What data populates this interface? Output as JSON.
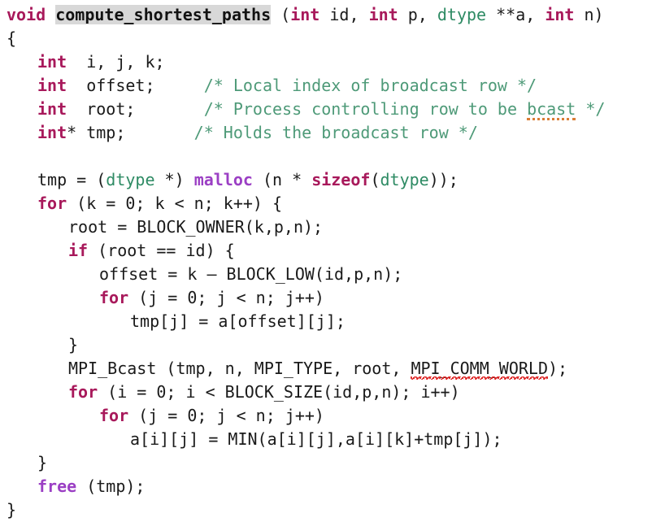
{
  "document": {
    "kind": "source-code-listing",
    "language": "C",
    "function_name": "compute_shortest_paths",
    "background_color": "#ffffff"
  },
  "theme": {
    "plain_color": "#1a1a1a",
    "keyword_color": "#a8195b",
    "builtin_color": "#9b3fc4",
    "type_color": "#2e8b64",
    "comment_color": "#4e9a78",
    "funcname_highlight_bg": "#d8d8d8",
    "spell_error_color": "#d42020",
    "grammar_warning_color": "#d9772b"
  },
  "lines": [
    {
      "indent": 0,
      "tokens": [
        {
          "text": "void",
          "type": "keyword"
        },
        {
          "text": " ",
          "type": "plain"
        },
        {
          "text": "compute_shortest_paths",
          "type": "funcname"
        },
        {
          "text": " (",
          "type": "plain"
        },
        {
          "text": "int",
          "type": "keyword"
        },
        {
          "text": " id, ",
          "type": "plain"
        },
        {
          "text": "int",
          "type": "keyword"
        },
        {
          "text": " p, ",
          "type": "plain"
        },
        {
          "text": "dtype",
          "type": "type"
        },
        {
          "text": " **a, ",
          "type": "plain"
        },
        {
          "text": "int",
          "type": "keyword"
        },
        {
          "text": " n)",
          "type": "plain"
        }
      ]
    },
    {
      "indent": 0,
      "tokens": [
        {
          "text": "{",
          "type": "plain"
        }
      ]
    },
    {
      "indent": 1,
      "tokens": [
        {
          "text": "int",
          "type": "keyword"
        },
        {
          "text": "  i, j, k;",
          "type": "plain"
        }
      ]
    },
    {
      "indent": 1,
      "tokens": [
        {
          "text": "int",
          "type": "keyword"
        },
        {
          "text": "  offset;     ",
          "type": "plain"
        },
        {
          "text": "/* Local index of broadcast row */",
          "type": "comment"
        }
      ]
    },
    {
      "indent": 1,
      "tokens": [
        {
          "text": "int",
          "type": "keyword"
        },
        {
          "text": "  root;       ",
          "type": "plain"
        },
        {
          "text": "/* Process controlling row to be ",
          "type": "comment"
        },
        {
          "text": "bcast",
          "type": "comment",
          "mark": "grammar"
        },
        {
          "text": " */",
          "type": "comment"
        }
      ]
    },
    {
      "indent": 1,
      "tokens": [
        {
          "text": "int",
          "type": "keyword"
        },
        {
          "text": "* tmp;       ",
          "type": "plain"
        },
        {
          "text": "/* Holds the broadcast row */",
          "type": "comment"
        }
      ]
    },
    {
      "indent": 0,
      "tokens": []
    },
    {
      "indent": 1,
      "tokens": [
        {
          "text": "tmp = (",
          "type": "plain"
        },
        {
          "text": "dtype",
          "type": "type"
        },
        {
          "text": " *) ",
          "type": "plain"
        },
        {
          "text": "malloc",
          "type": "builtin"
        },
        {
          "text": " (n * ",
          "type": "plain"
        },
        {
          "text": "sizeof",
          "type": "keyword"
        },
        {
          "text": "(",
          "type": "plain"
        },
        {
          "text": "dtype",
          "type": "type"
        },
        {
          "text": "));",
          "type": "plain"
        }
      ]
    },
    {
      "indent": 1,
      "tokens": [
        {
          "text": "for",
          "type": "keyword"
        },
        {
          "text": " (k = 0; k < n; k++) {",
          "type": "plain"
        }
      ]
    },
    {
      "indent": 2,
      "tokens": [
        {
          "text": "root = BLOCK_OWNER(k,p,n);",
          "type": "plain"
        }
      ]
    },
    {
      "indent": 2,
      "tokens": [
        {
          "text": "if",
          "type": "keyword"
        },
        {
          "text": " (root == id) {",
          "type": "plain"
        }
      ]
    },
    {
      "indent": 3,
      "tokens": [
        {
          "text": "offset = k – BLOCK_LOW(id,p,n);",
          "type": "plain"
        }
      ]
    },
    {
      "indent": 3,
      "tokens": [
        {
          "text": "for",
          "type": "keyword"
        },
        {
          "text": " (j = 0; j < n; j++)",
          "type": "plain"
        }
      ]
    },
    {
      "indent": 4,
      "tokens": [
        {
          "text": "tmp[j] = a[offset][j];",
          "type": "plain"
        }
      ]
    },
    {
      "indent": 2,
      "tokens": [
        {
          "text": "}",
          "type": "plain"
        }
      ]
    },
    {
      "indent": 2,
      "tokens": [
        {
          "text": "MPI_Bcast (tmp, n, MPI_TYPE, root, ",
          "type": "plain"
        },
        {
          "text": "MPI_COMM_WORLD",
          "type": "plain",
          "mark": "spell"
        },
        {
          "text": ");",
          "type": "plain"
        }
      ]
    },
    {
      "indent": 2,
      "tokens": [
        {
          "text": "for",
          "type": "keyword"
        },
        {
          "text": " (i = 0; i < BLOCK_SIZE(id,p,n); i++)",
          "type": "plain"
        }
      ]
    },
    {
      "indent": 3,
      "tokens": [
        {
          "text": "for",
          "type": "keyword"
        },
        {
          "text": " (j = 0; j < n; j++)",
          "type": "plain"
        }
      ]
    },
    {
      "indent": 4,
      "tokens": [
        {
          "text": "a[i][j] = MIN(a[i][j],a[i][k]+tmp[j]);",
          "type": "plain"
        }
      ]
    },
    {
      "indent": 1,
      "tokens": [
        {
          "text": "}",
          "type": "plain"
        }
      ]
    },
    {
      "indent": 1,
      "tokens": [
        {
          "text": "free",
          "type": "builtin"
        },
        {
          "text": " (tmp);",
          "type": "plain"
        }
      ]
    },
    {
      "indent": 0,
      "tokens": [
        {
          "text": "}",
          "type": "plain"
        }
      ]
    }
  ]
}
